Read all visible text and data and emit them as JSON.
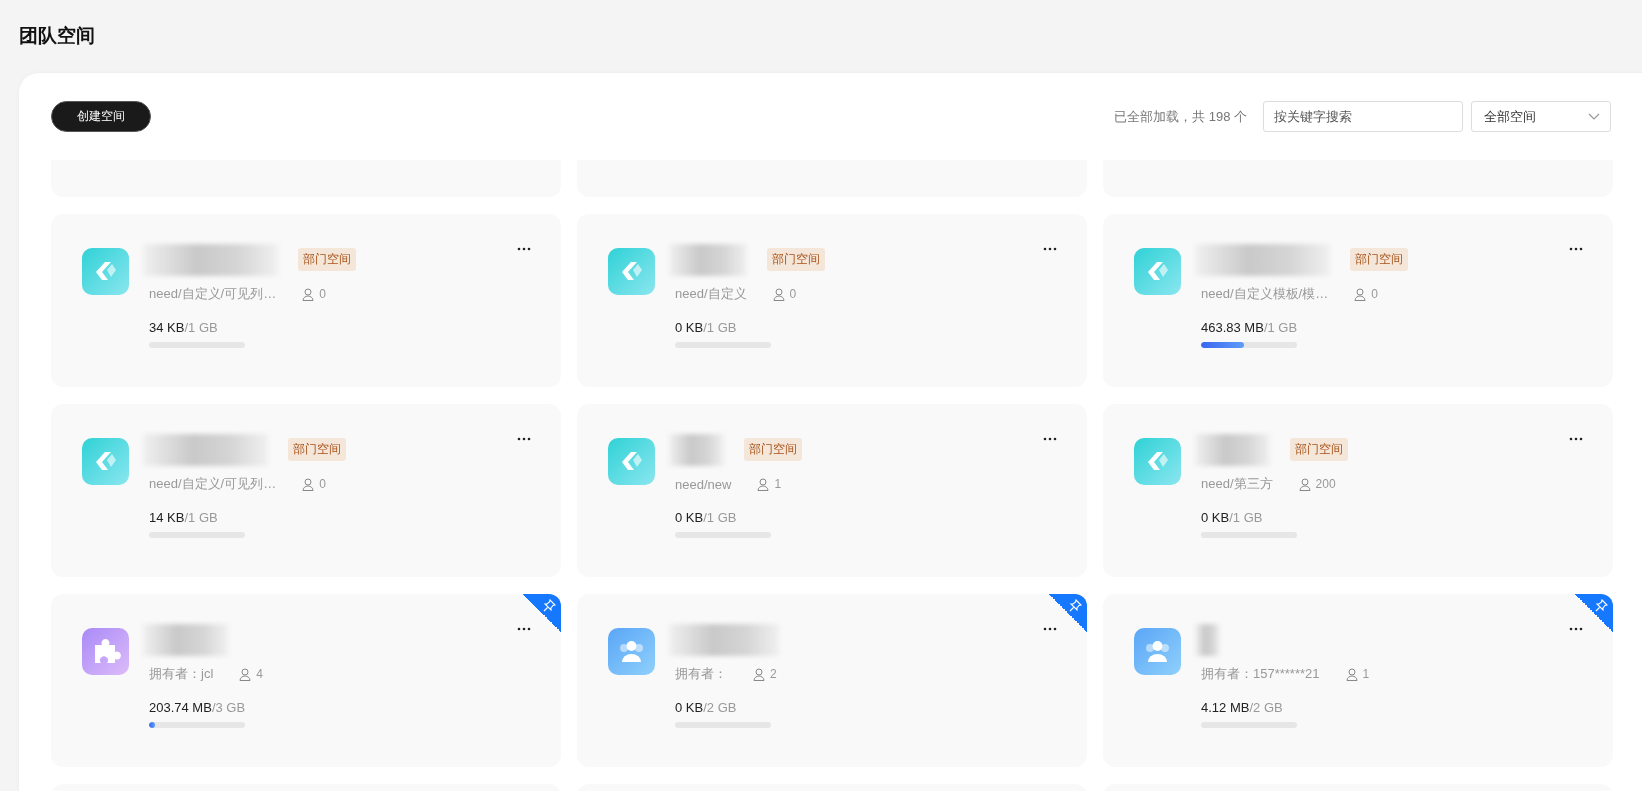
{
  "page": {
    "title": "团队空间"
  },
  "toolbar": {
    "create_button": "创建空间",
    "load_status": "已全部加载，共 198 个",
    "search": {
      "placeholder": "按关键字搜索"
    },
    "filter": {
      "value": "全部空间"
    }
  },
  "spaces": [
    {
      "kind": "team",
      "tag": "部门空间",
      "info": "need/自定义/可见列…",
      "members": "0",
      "used": "34 KB",
      "total": "/1 GB",
      "level": 0,
      "pinned": false
    },
    {
      "kind": "team",
      "tag": "部门空间",
      "info": "need/自定义",
      "members": "0",
      "used": "0 KB",
      "total": "/1 GB",
      "level": 0,
      "pinned": false
    },
    {
      "kind": "team",
      "tag": "部门空间",
      "info": "need/自定义模板/模…",
      "members": "0",
      "used": "463.83 MB",
      "total": "/1 GB",
      "level": 0.45,
      "pinned": false
    },
    {
      "kind": "team",
      "tag": "部门空间",
      "info": "need/自定义/可见列…",
      "members": "0",
      "used": "14 KB",
      "total": "/1 GB",
      "level": 0,
      "pinned": false
    },
    {
      "kind": "team",
      "tag": "部门空间",
      "info": "need/new",
      "members": "1",
      "used": "0 KB",
      "total": "/1 GB",
      "level": 0,
      "pinned": false
    },
    {
      "kind": "team",
      "tag": "部门空间",
      "info": "need/第三方",
      "members": "200",
      "used": "0 KB",
      "total": "/1 GB",
      "level": 0,
      "pinned": false
    },
    {
      "kind": "puzzle",
      "info": "拥有者：jcl",
      "members": "4",
      "used": "203.74 MB",
      "total": "/3 GB",
      "level": 0.066,
      "pinned": true
    },
    {
      "kind": "people",
      "info": "拥有者：",
      "members": "2",
      "used": "0 KB",
      "total": "/2 GB",
      "level": 0,
      "pinned": true
    },
    {
      "kind": "people",
      "info": "拥有者：157******21",
      "members": "1",
      "used": "4.12 MB",
      "total": "/2 GB",
      "level": 0,
      "pinned": true
    }
  ]
}
